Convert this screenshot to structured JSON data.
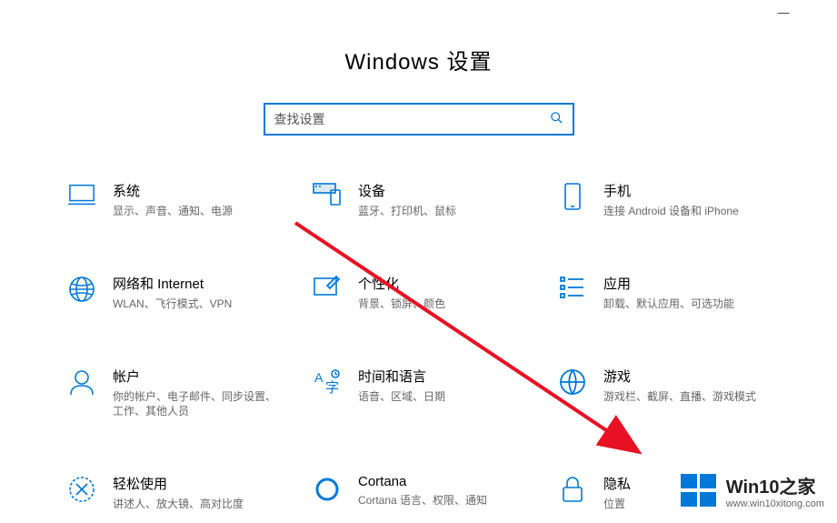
{
  "header": {
    "title": "Windows 设置"
  },
  "search": {
    "placeholder": "查找设置"
  },
  "tiles": {
    "system": {
      "title": "系统",
      "desc": "显示、声音、通知、电源"
    },
    "devices": {
      "title": "设备",
      "desc": "蓝牙、打印机、鼠标"
    },
    "phone": {
      "title": "手机",
      "desc": "连接 Android 设备和 iPhone"
    },
    "network": {
      "title": "网络和 Internet",
      "desc": "WLAN、飞行模式、VPN"
    },
    "personalize": {
      "title": "个性化",
      "desc": "背景、锁屏、颜色"
    },
    "apps": {
      "title": "应用",
      "desc": "卸载、默认应用、可选功能"
    },
    "accounts": {
      "title": "帐户",
      "desc": "你的帐户、电子邮件、同步设置、工作、其他人员"
    },
    "time": {
      "title": "时间和语言",
      "desc": "语音、区域、日期"
    },
    "gaming": {
      "title": "游戏",
      "desc": "游戏栏、截屏、直播、游戏模式"
    },
    "ease": {
      "title": "轻松使用",
      "desc": "讲述人、放大镜、高对比度"
    },
    "cortana": {
      "title": "Cortana",
      "desc": "Cortana 语言、权限、通知"
    },
    "privacy": {
      "title": "隐私",
      "desc": "位置"
    }
  },
  "watermark": {
    "title": "Win10之家",
    "url": "www.win10xitong.com"
  },
  "windowControls": {
    "minimize": "—"
  }
}
